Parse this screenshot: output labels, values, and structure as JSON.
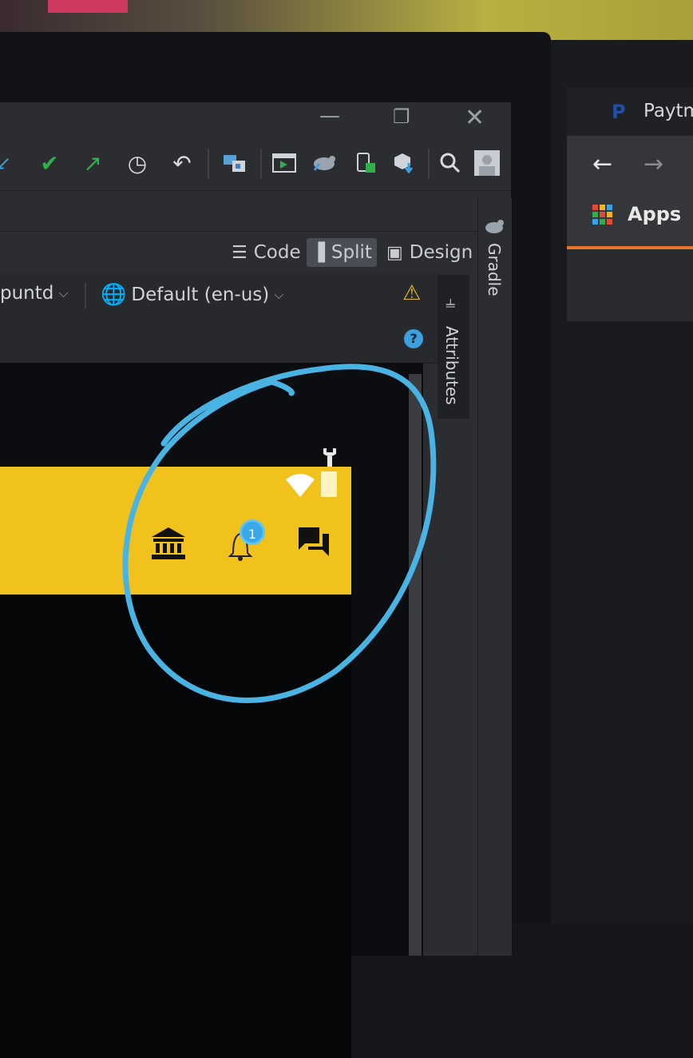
{
  "ide": {
    "view_tabs": [
      {
        "label": "Code"
      },
      {
        "label": "Split"
      },
      {
        "label": "Design"
      }
    ],
    "locale_row": {
      "device_partial": "puntd",
      "locale": "Default (en-us)"
    },
    "side_panels": {
      "attributes": "Attributes",
      "gradle": "Gradle"
    },
    "preview": {
      "notification_badge_count": "1",
      "app_bar_color": "#f2c21c"
    }
  },
  "browser": {
    "tab_title": "Paytm",
    "bookmarks": {
      "apps_label": "Apps"
    }
  },
  "colors": {
    "accent_green": "#2fae4a",
    "accent_blue": "#3aa0e0",
    "annotation_blue": "#49b3e3",
    "warning_yellow": "#e6b82a",
    "chrome_orange": "#e8742c"
  }
}
